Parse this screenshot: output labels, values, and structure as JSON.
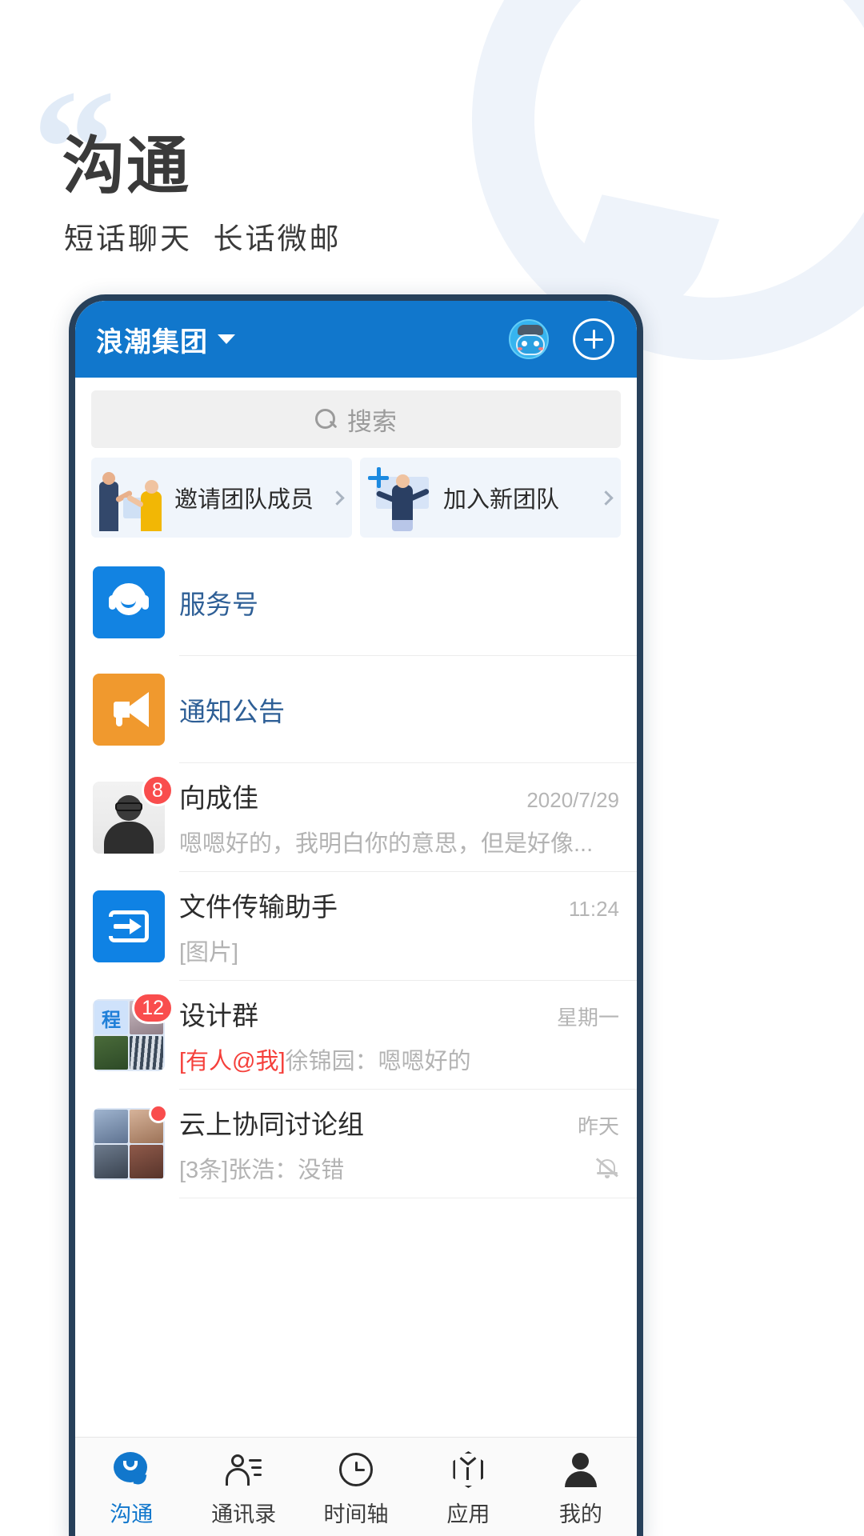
{
  "hero": {
    "quote_glyph": "“",
    "title_part1": "沟",
    "title_part2": "通",
    "subtitle": "短话聊天  长话微邮"
  },
  "appbar": {
    "org_name": "浪潮集团",
    "caret_icon": "chevron-down-icon",
    "avatar_icon": "robot-avatar-icon",
    "add_icon": "plus-circle-icon"
  },
  "search": {
    "placeholder": "搜索",
    "icon": "search-icon"
  },
  "promos": [
    {
      "label": "邀请团队成员",
      "icon": "invite-members-illustration",
      "arrow": "chevron-right-icon"
    },
    {
      "label": "加入新团队",
      "icon": "join-team-illustration",
      "arrow": "chevron-right-icon"
    }
  ],
  "conversations": [
    {
      "title": "服务号",
      "title_style": "link",
      "avatar": "service-account-icon",
      "time": "",
      "preview": "",
      "badge": "",
      "muted": false
    },
    {
      "title": "通知公告",
      "title_style": "link",
      "avatar": "announcement-icon",
      "time": "",
      "preview": "",
      "badge": "",
      "muted": false
    },
    {
      "title": "向成佳",
      "title_style": "normal",
      "avatar": "user-photo-avatar",
      "time": "2020/7/29",
      "preview": "嗯嗯好的，我明白你的意思，但是好像...",
      "badge": "8",
      "muted": false
    },
    {
      "title": "文件传输助手",
      "title_style": "normal",
      "avatar": "file-transfer-icon",
      "time": "11:24",
      "preview": "[图片]",
      "badge": "",
      "muted": false
    },
    {
      "title": "设计群",
      "title_style": "normal",
      "avatar": "group-avatar-grid",
      "time": "星期一",
      "preview_tag": "[有人@我]",
      "preview": "徐锦园：嗯嗯好的",
      "badge": "12",
      "muted": false
    },
    {
      "title": "云上协同讨论组",
      "title_style": "normal",
      "avatar": "group-avatar-grid",
      "time": "昨天",
      "preview": "[3条]张浩：没错",
      "badge": "dot",
      "muted": true,
      "mute_icon": "bell-off-icon"
    }
  ],
  "group_avatar_initial": "程",
  "tabbar": [
    {
      "label": "沟通",
      "icon": "chat-bubble-icon",
      "active": true
    },
    {
      "label": "通讯录",
      "icon": "contacts-icon",
      "active": false
    },
    {
      "label": "时间轴",
      "icon": "clock-icon",
      "active": false
    },
    {
      "label": "应用",
      "icon": "cube-icon",
      "active": false
    },
    {
      "label": "我的",
      "icon": "person-icon",
      "active": false
    }
  ],
  "colors": {
    "brand_blue": "#1177cc",
    "accent_blue": "#1a88e0",
    "badge_red": "#f94d4d",
    "notice_orange": "#f0992e",
    "at_red": "#f5403b",
    "tint_bg": "#eef3fa"
  }
}
